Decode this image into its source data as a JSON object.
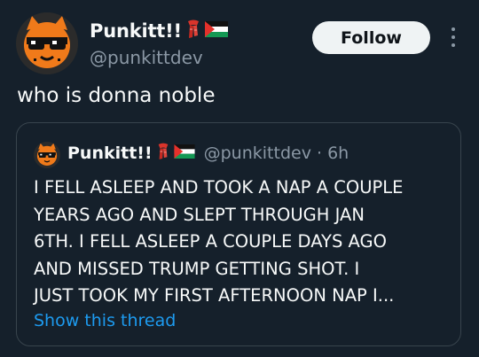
{
  "author": {
    "display_name": "Punkitt!!",
    "handle": "@punkittdev",
    "badges": [
      "red-scarf-emoji",
      "palestine-flag-emoji"
    ]
  },
  "follow_label": "Follow",
  "tweet_text": "who is donna noble",
  "quote": {
    "display_name": "Punkitt!!",
    "handle_time": "@punkittdev · 6h",
    "text_lines": [
      "I FELL ASLEEP AND TOOK A NAP A COUPLE",
      "YEARS AGO AND SLEPT THROUGH JAN",
      "6TH. I FELL ASLEEP A COUPLE DAYS AGO",
      "AND MISSED TRUMP GETTING SHOT. I",
      "JUST TOOK MY FIRST AFTERNOON NAP I..."
    ],
    "show_thread_label": "Show this thread"
  },
  "colors": {
    "background": "#15202b",
    "text": "#f7f9f9",
    "secondary": "#8b98a5",
    "link": "#1d9bf0",
    "border": "#38444d",
    "avatar_orange": "#f07a1a"
  }
}
